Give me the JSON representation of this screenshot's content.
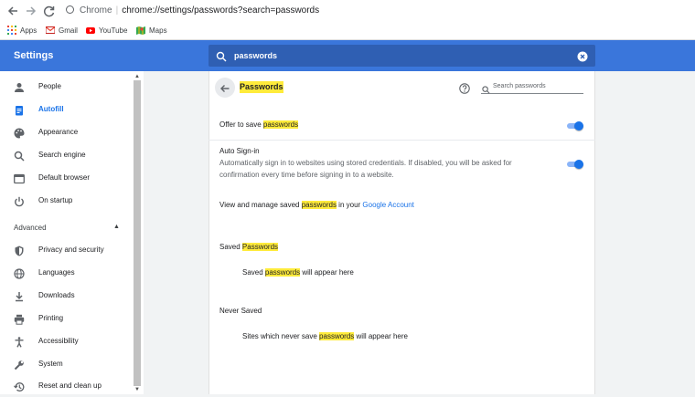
{
  "browser": {
    "back_icon": "back-arrow-icon",
    "forward_icon": "forward-arrow-icon",
    "reload_icon": "reload-icon",
    "site_label": "Chrome",
    "url_path": "chrome://settings/passwords?search=passwords"
  },
  "bookmarks": [
    {
      "label": "Apps",
      "icon": "apps-grid-icon"
    },
    {
      "label": "Gmail",
      "icon": "gmail-icon"
    },
    {
      "label": "YouTube",
      "icon": "youtube-icon"
    },
    {
      "label": "Maps",
      "icon": "maps-icon"
    }
  ],
  "header": {
    "title": "Settings",
    "search_value": "passwords",
    "accent_color": "#3a76db"
  },
  "sidebar": {
    "items": [
      {
        "label": "People",
        "icon": "person-icon"
      },
      {
        "label": "Autofill",
        "icon": "clipboard-icon",
        "active": true
      },
      {
        "label": "Appearance",
        "icon": "palette-icon"
      },
      {
        "label": "Search engine",
        "icon": "search-icon"
      },
      {
        "label": "Default browser",
        "icon": "browser-icon"
      },
      {
        "label": "On startup",
        "icon": "power-icon"
      }
    ],
    "advanced_label": "Advanced",
    "advanced_items": [
      {
        "label": "Privacy and security",
        "icon": "shield-icon"
      },
      {
        "label": "Languages",
        "icon": "globe-icon"
      },
      {
        "label": "Downloads",
        "icon": "download-icon"
      },
      {
        "label": "Printing",
        "icon": "printer-icon"
      },
      {
        "label": "Accessibility",
        "icon": "accessibility-icon"
      },
      {
        "label": "System",
        "icon": "wrench-icon"
      },
      {
        "label": "Reset and clean up",
        "icon": "history-icon"
      }
    ]
  },
  "main": {
    "title": "Passwords",
    "search_placeholder": "Search passwords",
    "offer_save": {
      "prefix": "Offer to save ",
      "highlight": "passwords",
      "enabled": true
    },
    "auto_signin": {
      "title": "Auto Sign-in",
      "description": "Automatically sign in to websites using stored credentials. If disabled, you will be asked for confirmation every time before signing in to a website.",
      "enabled": true
    },
    "manage": {
      "prefix": "View and manage saved ",
      "highlight": "passwords",
      "middle": " in your ",
      "link": "Google Account"
    },
    "saved": {
      "prefix": "Saved ",
      "highlight": "Passwords",
      "empty_prefix": "Saved ",
      "empty_highlight": "passwords",
      "empty_suffix": " will appear here"
    },
    "never_saved": {
      "title": "Never Saved",
      "empty_prefix": "Sites which never save ",
      "empty_highlight": "passwords",
      "empty_suffix": " will appear here"
    },
    "highlight_color": "#ffeb3b"
  }
}
